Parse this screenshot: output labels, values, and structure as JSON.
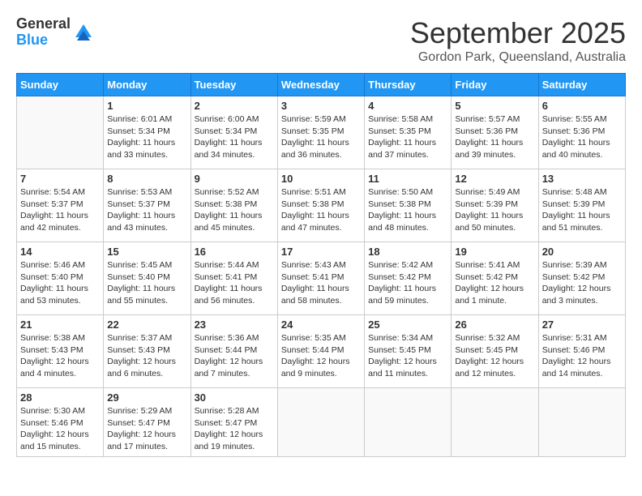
{
  "logo": {
    "general": "General",
    "blue": "Blue"
  },
  "header": {
    "month": "September 2025",
    "location": "Gordon Park, Queensland, Australia"
  },
  "weekdays": [
    "Sunday",
    "Monday",
    "Tuesday",
    "Wednesday",
    "Thursday",
    "Friday",
    "Saturday"
  ],
  "weeks": [
    [
      {
        "day": "",
        "info": ""
      },
      {
        "day": "1",
        "info": "Sunrise: 6:01 AM\nSunset: 5:34 PM\nDaylight: 11 hours\nand 33 minutes."
      },
      {
        "day": "2",
        "info": "Sunrise: 6:00 AM\nSunset: 5:34 PM\nDaylight: 11 hours\nand 34 minutes."
      },
      {
        "day": "3",
        "info": "Sunrise: 5:59 AM\nSunset: 5:35 PM\nDaylight: 11 hours\nand 36 minutes."
      },
      {
        "day": "4",
        "info": "Sunrise: 5:58 AM\nSunset: 5:35 PM\nDaylight: 11 hours\nand 37 minutes."
      },
      {
        "day": "5",
        "info": "Sunrise: 5:57 AM\nSunset: 5:36 PM\nDaylight: 11 hours\nand 39 minutes."
      },
      {
        "day": "6",
        "info": "Sunrise: 5:55 AM\nSunset: 5:36 PM\nDaylight: 11 hours\nand 40 minutes."
      }
    ],
    [
      {
        "day": "7",
        "info": "Sunrise: 5:54 AM\nSunset: 5:37 PM\nDaylight: 11 hours\nand 42 minutes."
      },
      {
        "day": "8",
        "info": "Sunrise: 5:53 AM\nSunset: 5:37 PM\nDaylight: 11 hours\nand 43 minutes."
      },
      {
        "day": "9",
        "info": "Sunrise: 5:52 AM\nSunset: 5:38 PM\nDaylight: 11 hours\nand 45 minutes."
      },
      {
        "day": "10",
        "info": "Sunrise: 5:51 AM\nSunset: 5:38 PM\nDaylight: 11 hours\nand 47 minutes."
      },
      {
        "day": "11",
        "info": "Sunrise: 5:50 AM\nSunset: 5:38 PM\nDaylight: 11 hours\nand 48 minutes."
      },
      {
        "day": "12",
        "info": "Sunrise: 5:49 AM\nSunset: 5:39 PM\nDaylight: 11 hours\nand 50 minutes."
      },
      {
        "day": "13",
        "info": "Sunrise: 5:48 AM\nSunset: 5:39 PM\nDaylight: 11 hours\nand 51 minutes."
      }
    ],
    [
      {
        "day": "14",
        "info": "Sunrise: 5:46 AM\nSunset: 5:40 PM\nDaylight: 11 hours\nand 53 minutes."
      },
      {
        "day": "15",
        "info": "Sunrise: 5:45 AM\nSunset: 5:40 PM\nDaylight: 11 hours\nand 55 minutes."
      },
      {
        "day": "16",
        "info": "Sunrise: 5:44 AM\nSunset: 5:41 PM\nDaylight: 11 hours\nand 56 minutes."
      },
      {
        "day": "17",
        "info": "Sunrise: 5:43 AM\nSunset: 5:41 PM\nDaylight: 11 hours\nand 58 minutes."
      },
      {
        "day": "18",
        "info": "Sunrise: 5:42 AM\nSunset: 5:42 PM\nDaylight: 11 hours\nand 59 minutes."
      },
      {
        "day": "19",
        "info": "Sunrise: 5:41 AM\nSunset: 5:42 PM\nDaylight: 12 hours\nand 1 minute."
      },
      {
        "day": "20",
        "info": "Sunrise: 5:39 AM\nSunset: 5:42 PM\nDaylight: 12 hours\nand 3 minutes."
      }
    ],
    [
      {
        "day": "21",
        "info": "Sunrise: 5:38 AM\nSunset: 5:43 PM\nDaylight: 12 hours\nand 4 minutes."
      },
      {
        "day": "22",
        "info": "Sunrise: 5:37 AM\nSunset: 5:43 PM\nDaylight: 12 hours\nand 6 minutes."
      },
      {
        "day": "23",
        "info": "Sunrise: 5:36 AM\nSunset: 5:44 PM\nDaylight: 12 hours\nand 7 minutes."
      },
      {
        "day": "24",
        "info": "Sunrise: 5:35 AM\nSunset: 5:44 PM\nDaylight: 12 hours\nand 9 minutes."
      },
      {
        "day": "25",
        "info": "Sunrise: 5:34 AM\nSunset: 5:45 PM\nDaylight: 12 hours\nand 11 minutes."
      },
      {
        "day": "26",
        "info": "Sunrise: 5:32 AM\nSunset: 5:45 PM\nDaylight: 12 hours\nand 12 minutes."
      },
      {
        "day": "27",
        "info": "Sunrise: 5:31 AM\nSunset: 5:46 PM\nDaylight: 12 hours\nand 14 minutes."
      }
    ],
    [
      {
        "day": "28",
        "info": "Sunrise: 5:30 AM\nSunset: 5:46 PM\nDaylight: 12 hours\nand 15 minutes."
      },
      {
        "day": "29",
        "info": "Sunrise: 5:29 AM\nSunset: 5:47 PM\nDaylight: 12 hours\nand 17 minutes."
      },
      {
        "day": "30",
        "info": "Sunrise: 5:28 AM\nSunset: 5:47 PM\nDaylight: 12 hours\nand 19 minutes."
      },
      {
        "day": "",
        "info": ""
      },
      {
        "day": "",
        "info": ""
      },
      {
        "day": "",
        "info": ""
      },
      {
        "day": "",
        "info": ""
      }
    ]
  ]
}
